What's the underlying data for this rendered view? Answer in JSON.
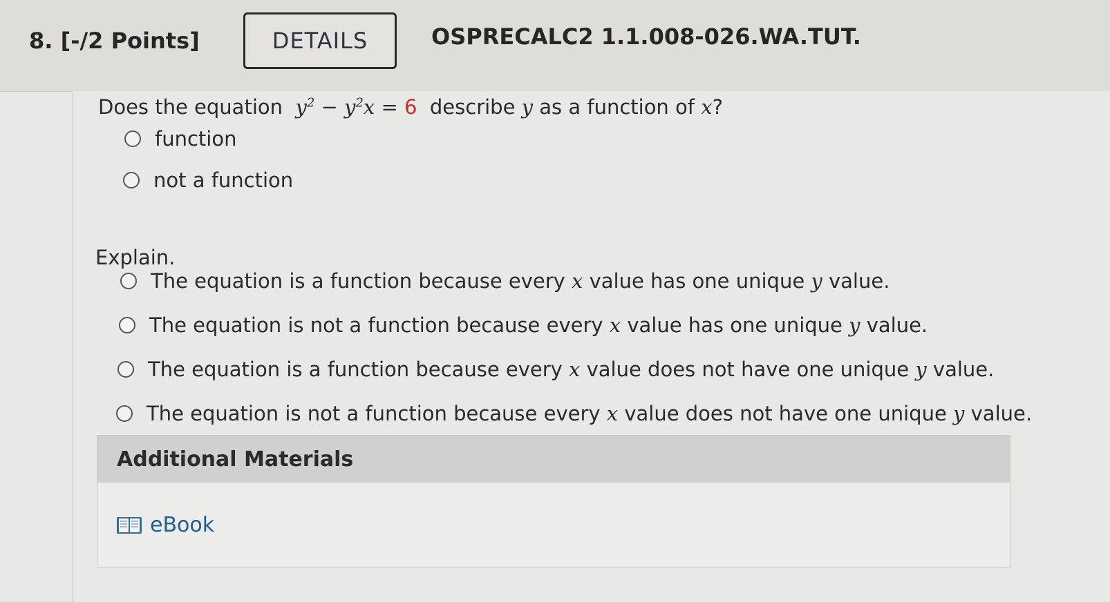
{
  "header": {
    "question_number": "8.",
    "points": "[-/2 Points]",
    "details_label": "DETAILS",
    "problem_code": "OSPRECALC2 1.1.008-026.WA.TUT."
  },
  "question": {
    "prefix": "Does the equation",
    "eq_y1": "y",
    "eq_exp1": "2",
    "eq_minus": " − ",
    "eq_y2": "y",
    "eq_exp2": "2",
    "eq_x": "x",
    "eq_equals": " = ",
    "eq_rhs": "6",
    "middle": "describe",
    "var_y": "y",
    "middle2": "as a function of",
    "var_x": "x",
    "suffix": "?",
    "options": [
      "function",
      "not a function"
    ]
  },
  "explain": {
    "label": "Explain.",
    "options": [
      {
        "a": "The equation is a function because every ",
        "x": "x",
        "b": " value has one unique ",
        "y": "y",
        "c": " value."
      },
      {
        "a": "The equation is not a function because every ",
        "x": "x",
        "b": " value has one unique ",
        "y": "y",
        "c": " value."
      },
      {
        "a": "The equation is a function because every ",
        "x": "x",
        "b": " value does not have one unique ",
        "y": "y",
        "c": " value."
      },
      {
        "a": "The equation is not a function because every ",
        "x": "x",
        "b": " value does not have one unique ",
        "y": "y",
        "c": " value."
      }
    ]
  },
  "materials": {
    "title": "Additional Materials",
    "ebook_label": "eBook",
    "icon": "book-icon"
  },
  "colors": {
    "accent_red": "#c8322a",
    "link_blue": "#1f5e8c"
  }
}
